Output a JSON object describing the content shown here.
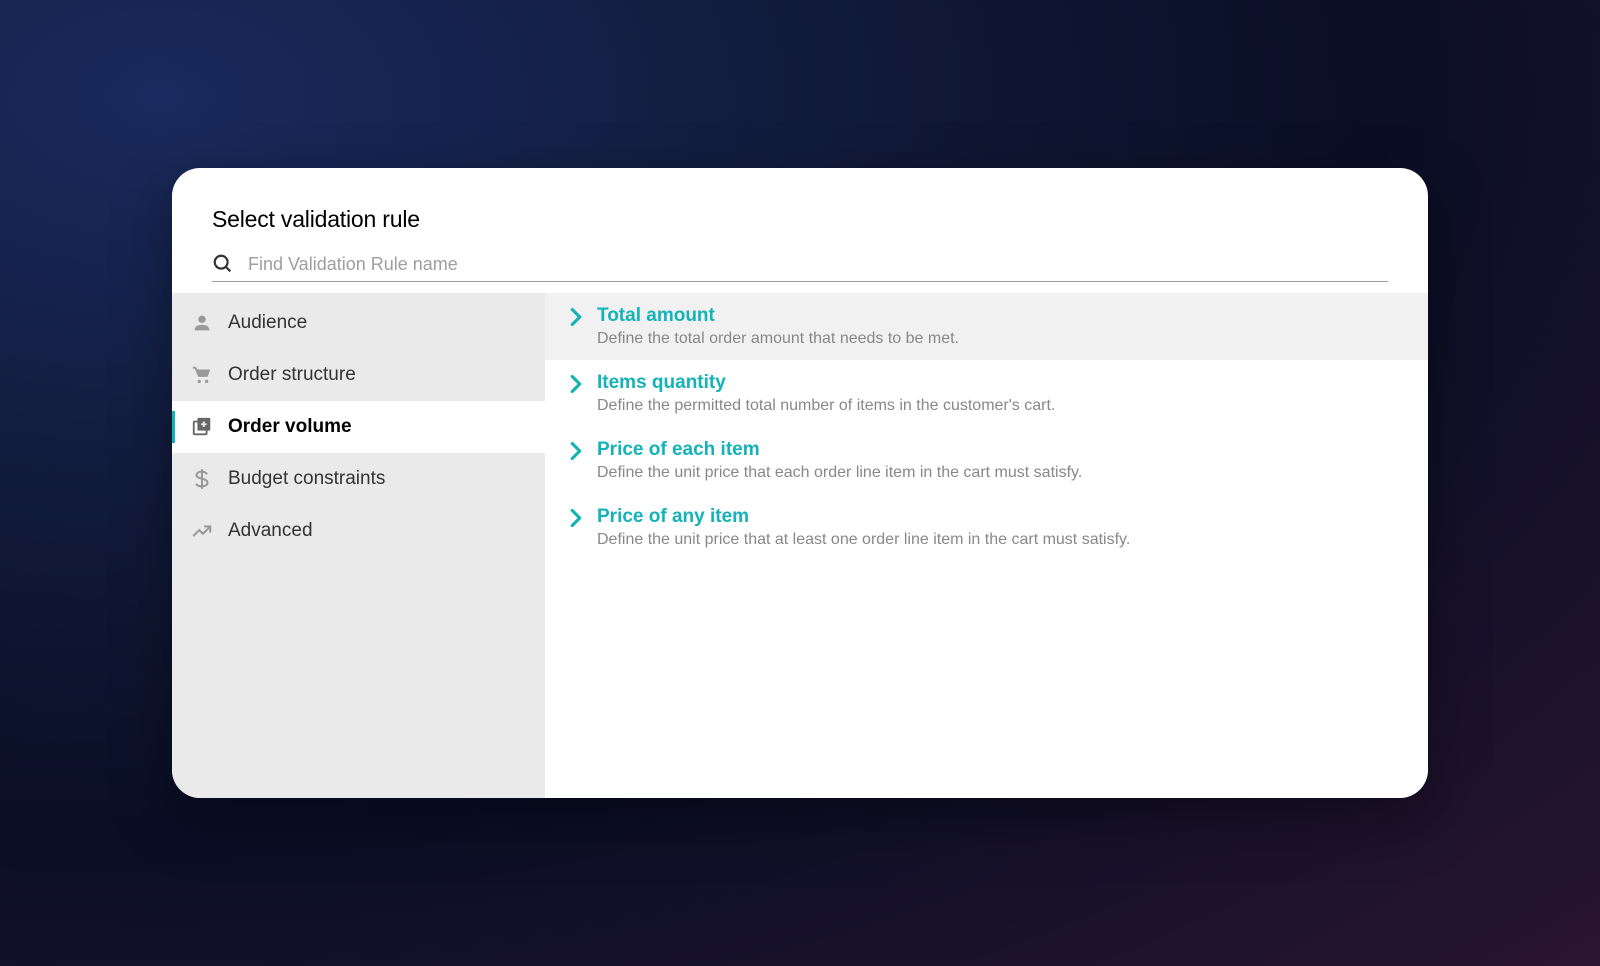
{
  "header": {
    "title": "Select validation rule"
  },
  "search": {
    "placeholder": "Find Validation Rule name"
  },
  "sidebar": {
    "items": [
      {
        "label": "Audience",
        "icon": "person-icon",
        "active": false
      },
      {
        "label": "Order structure",
        "icon": "cart-icon",
        "active": false
      },
      {
        "label": "Order volume",
        "icon": "add-box-icon",
        "active": true
      },
      {
        "label": "Budget constraints",
        "icon": "dollar-icon",
        "active": false
      },
      {
        "label": "Advanced",
        "icon": "trend-icon",
        "active": false
      }
    ]
  },
  "rules": [
    {
      "title": "Total amount",
      "description": "Define the total order amount that needs to be met.",
      "highlighted": true
    },
    {
      "title": "Items quantity",
      "description": "Define the permitted total number of items in the customer's cart.",
      "highlighted": false
    },
    {
      "title": "Price of each item",
      "description": "Define the unit price that each order line item in the cart must satisfy.",
      "highlighted": false
    },
    {
      "title": "Price of any item",
      "description": "Define the unit price that at least one order line item in the cart must satisfy.",
      "highlighted": false
    }
  ]
}
